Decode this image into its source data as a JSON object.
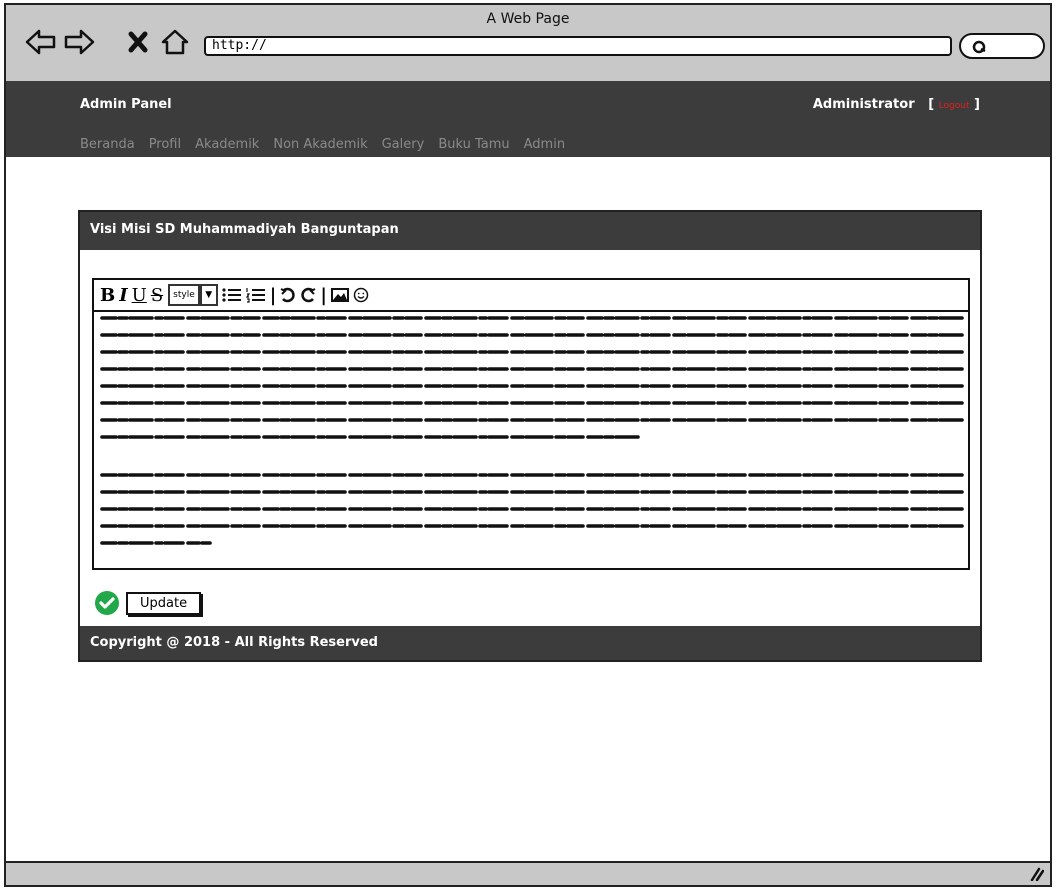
{
  "browser": {
    "title": "A Web Page",
    "url": "http://"
  },
  "header": {
    "brand": "Admin Panel",
    "user": "Administrator",
    "bracket_open": "[",
    "logout": "Logout",
    "bracket_close": "]"
  },
  "menu": [
    "Beranda",
    "Profil",
    "Akademik",
    "Non Akademik",
    "Galery",
    "Buku Tamu",
    "Admin"
  ],
  "panel": {
    "title": "Visi Misi SD Muhammadiyah Banguntapan",
    "toolbar": {
      "bold": "B",
      "italic": "I",
      "underline": "U",
      "strike": "S",
      "style": "style"
    },
    "update_label": "Update",
    "footer": "Copyright @ 2018 - All Rights Reserved"
  }
}
